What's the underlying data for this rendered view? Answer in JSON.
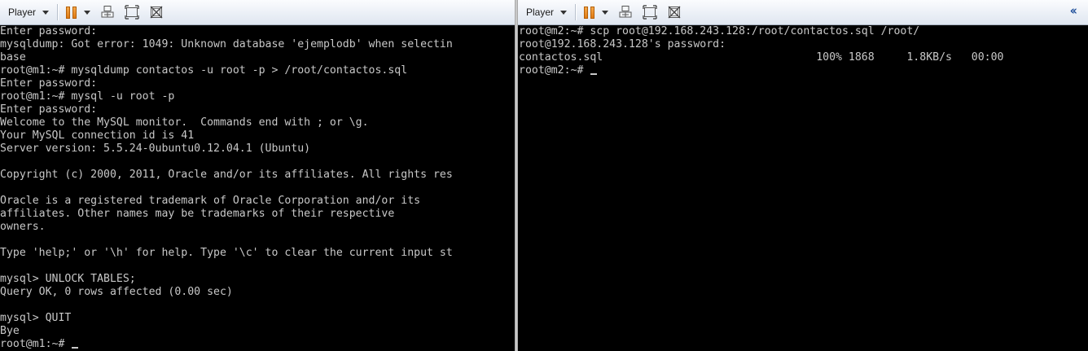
{
  "left_vm": {
    "toolbar": {
      "player_label": "Player"
    },
    "terminal": {
      "lines": [
        "Enter password:",
        "mysqldump: Got error: 1049: Unknown database 'ejemplodb' when selectin",
        "base",
        "root@m1:~# mysqldump contactos -u root -p > /root/contactos.sql",
        "Enter password:",
        "root@m1:~# mysql -u root -p",
        "Enter password:",
        "Welcome to the MySQL monitor.  Commands end with ; or \\g.",
        "Your MySQL connection id is 41",
        "Server version: 5.5.24-0ubuntu0.12.04.1 (Ubuntu)",
        "",
        "Copyright (c) 2000, 2011, Oracle and/or its affiliates. All rights res",
        "",
        "Oracle is a registered trademark of Oracle Corporation and/or its",
        "affiliates. Other names may be trademarks of their respective",
        "owners.",
        "",
        "Type 'help;' or '\\h' for help. Type '\\c' to clear the current input st",
        "",
        "mysql> UNLOCK TABLES;",
        "Query OK, 0 rows affected (0.00 sec)",
        "",
        "mysql> QUIT",
        "Bye"
      ],
      "prompt": "root@m1:~# "
    }
  },
  "right_vm": {
    "toolbar": {
      "player_label": "Player"
    },
    "terminal": {
      "lines": [
        "root@m2:~# scp root@192.168.243.128:/root/contactos.sql /root/",
        "root@192.168.243.128's password:",
        "contactos.sql                                 100% 1868     1.8KB/s   00:00"
      ],
      "prompt": "root@m2:~# "
    }
  },
  "icons": {
    "player_menu": "chevron-down-icon",
    "pause": "pause-icon",
    "send_keys": "ctrl-alt-del-icon",
    "fit_guest": "fit-window-icon",
    "unity": "unity-mode-icon",
    "collapse": "double-chevron-left-icon"
  },
  "colors": {
    "terminal_bg": "#000000",
    "terminal_fg": "#c8c8c8",
    "pause_accent": "#e07a12",
    "collapse_accent": "#1f4f9a"
  }
}
